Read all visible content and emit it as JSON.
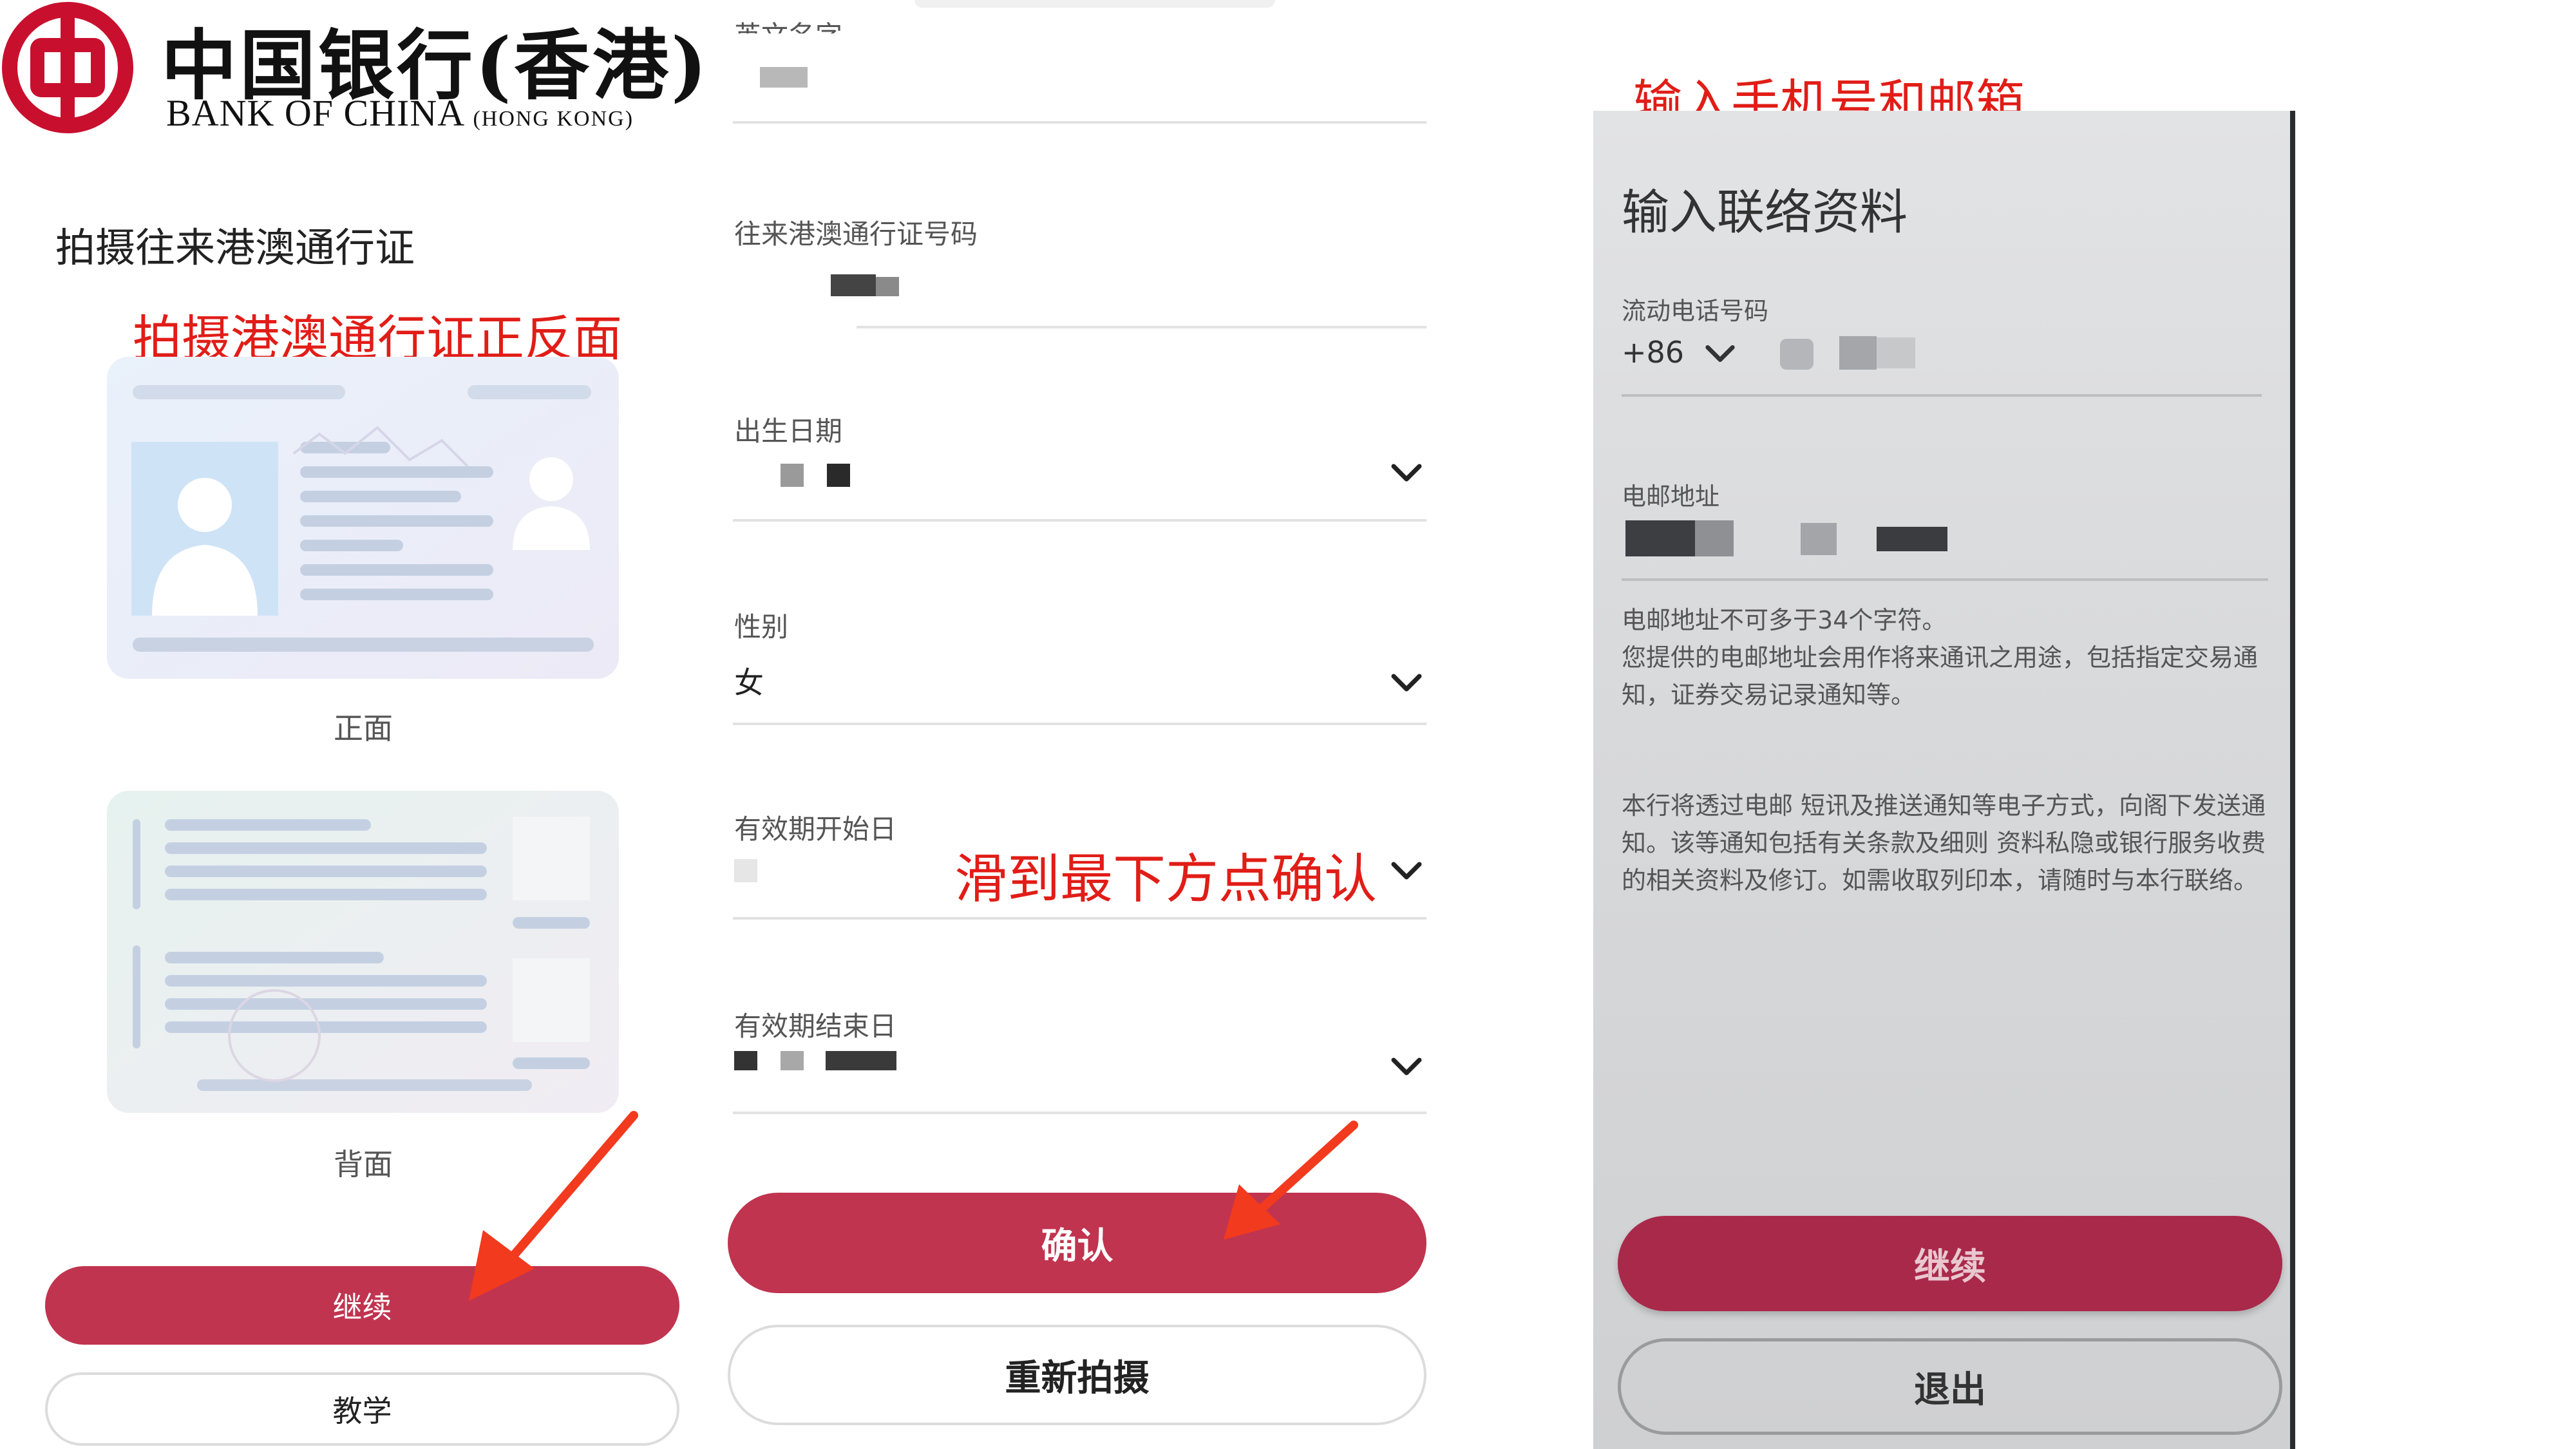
{
  "logo": {
    "name_cn": "中国银行(香港)",
    "name_en": "BANK OF CHINA",
    "name_en_suffix": "(HONG KONG)",
    "brand_red": "#c8102e"
  },
  "panel1": {
    "title": "拍摄往来港澳通行证",
    "annotation": "拍摄港澳通行证正反面",
    "front_caption": "正面",
    "back_caption": "背面",
    "continue_label": "继续",
    "tutorial_label": "教学"
  },
  "panel2": {
    "fields": [
      {
        "label": "英文名字",
        "value": ""
      },
      {
        "label": "往来港澳通行证号码",
        "value": ""
      },
      {
        "label": "出生日期",
        "value": ""
      },
      {
        "label": "性别",
        "value": "女"
      },
      {
        "label": "有效期开始日",
        "value": ""
      },
      {
        "label": "有效期结束日",
        "value": ""
      }
    ],
    "annotation": "滑到最下方点确认",
    "confirm_label": "确认",
    "retake_label": "重新拍摄"
  },
  "panel3": {
    "annotation": "输入手机号和邮箱",
    "title": "输入联络资料",
    "phone_label": "流动电话号码",
    "country_code": "+86",
    "email_label": "电邮地址",
    "email_note_1": "电邮地址不可多于34个字符。",
    "email_note_2": "您提供的电邮地址会用作将来通讯之用途，包括指定交易通知，证券交易记录通知等。",
    "disclaimer": "本行将透过电邮 短讯及推送通知等电子方式，向阁下发送通知。该等通知包括有关条款及细则 资料私隐或银行服务收费的相关资料及修订。如需收取列印本，请随时与本行联络。",
    "continue_label": "继续",
    "exit_label": "退出"
  },
  "colors": {
    "primary_button": "#c0344f",
    "annotation_red": "#e11d17",
    "arrow_red": "#f23a1e"
  }
}
